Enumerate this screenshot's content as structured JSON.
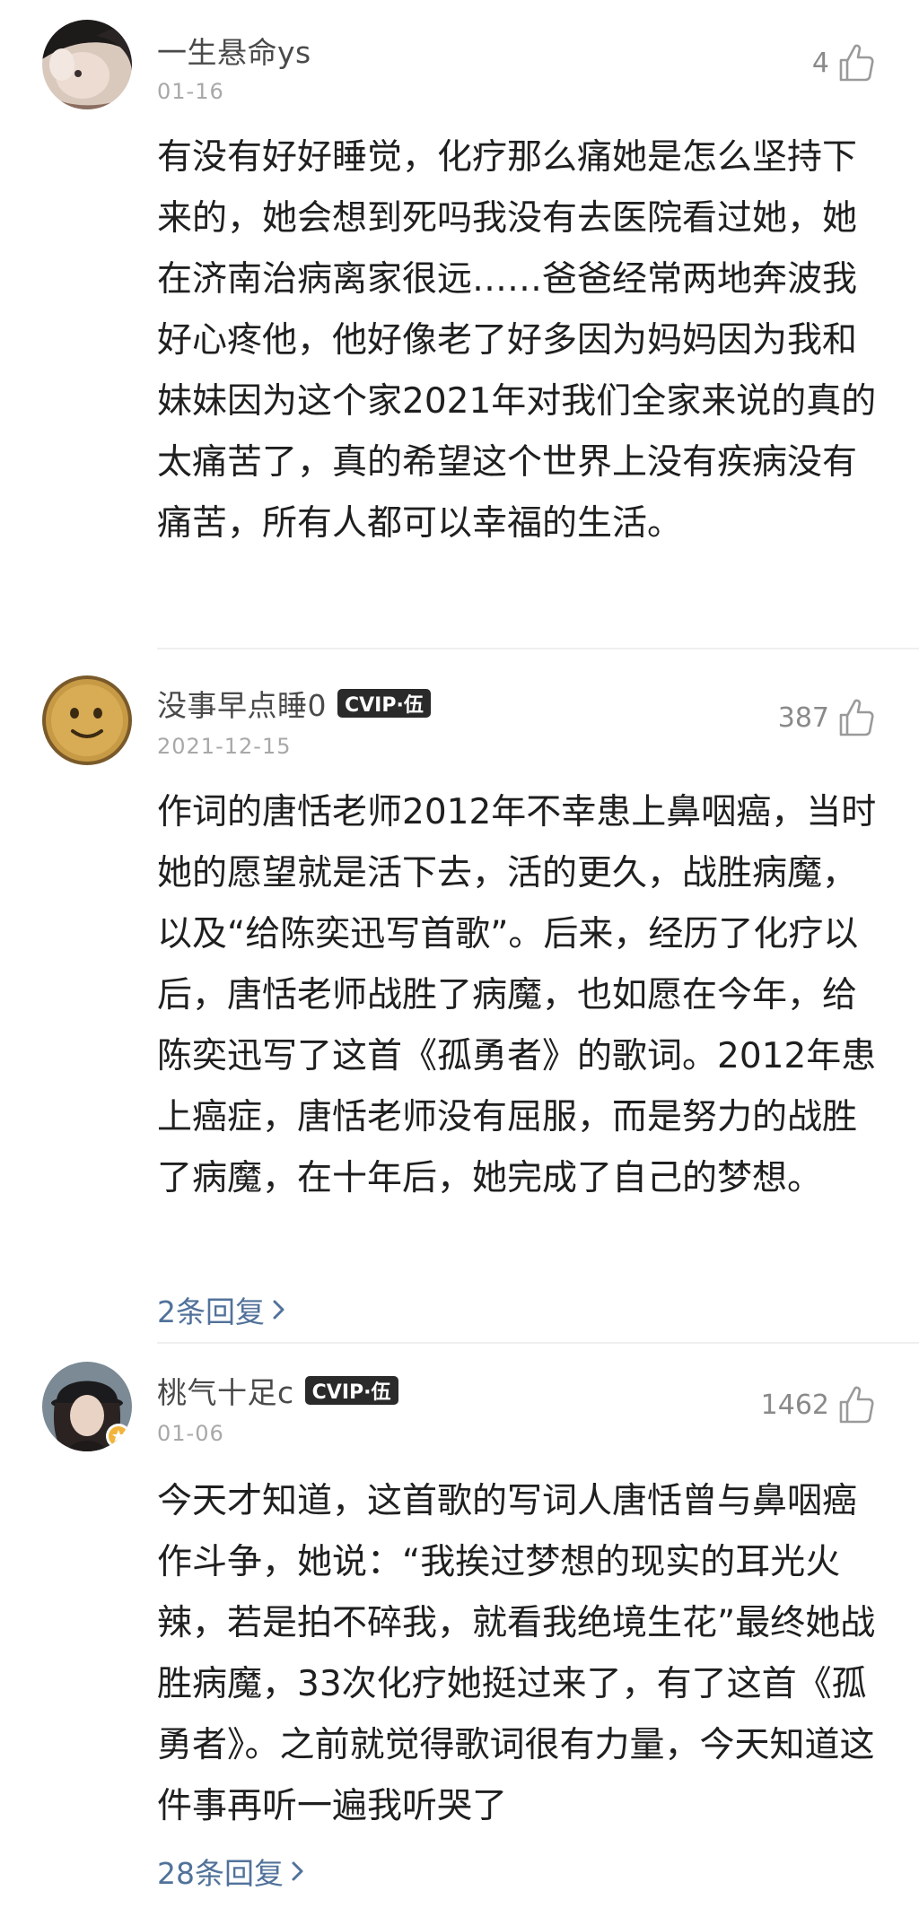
{
  "comments": [
    {
      "username": "一生悬命ys",
      "date": "01-16",
      "likes": "4",
      "body": "有没有好好睡觉，化疗那么痛她是怎么坚持下来的，她会想到死吗我没有去医院看过她，她在济南治病离家很远……爸爸经常两地奔波我好心疼他，他好像老了好多因为妈妈因为我和妹妹因为这个家2021年对我们全家来说的真的太痛苦了，真的希望这个世界上没有疾病没有痛苦，所有人都可以幸福的生活。"
    },
    {
      "username": "没事早点睡0",
      "badge": "CVIP·伍",
      "date": "2021-12-15",
      "likes": "387",
      "body": "作词的唐恬老师2012年不幸患上鼻咽癌，当时她的愿望就是活下去，活的更久，战胜病魔，以及“给陈奕迅写首歌”。后来，经历了化疗以后，唐恬老师战胜了病魔，也如愿在今年，给陈奕迅写了这首《孤勇者》的歌词。2012年患上癌症，唐恬老师没有屈服，而是努力的战胜了病魔，在十年后，她完成了自己的梦想。",
      "replies": "2条回复"
    },
    {
      "username": "桃气十足c",
      "badge": "CVIP·伍",
      "date": "01-06",
      "likes": "1462",
      "body": "今天才知道，这首歌的写词人唐恬曾与鼻咽癌作斗争，她说：“我挨过梦想的现实的耳光火辣，若是拍不碎我，就看我绝境生花”最终她战胜病魔，33次化疗她挺过来了，有了这首《孤勇者》。之前就觉得歌词很有力量，今天知道这件事再听一遍我听哭了",
      "replies": "28条回复"
    }
  ],
  "icons": {
    "like": "thumbs-up-icon",
    "chevron": "chevron-right-icon"
  }
}
